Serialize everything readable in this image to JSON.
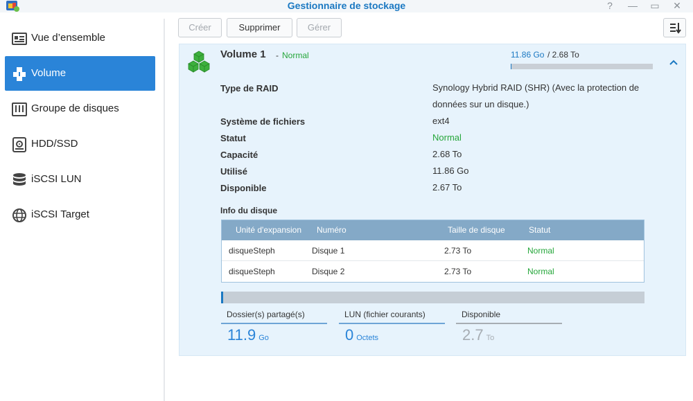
{
  "window": {
    "title": "Gestionnaire de stockage",
    "help_glyph": "?",
    "minimize_glyph": "—",
    "maximize_glyph": "▭",
    "close_glyph": "✕"
  },
  "sidebar": {
    "items": [
      {
        "label": "Vue d’ensemble",
        "icon": "overview-icon",
        "active": false
      },
      {
        "label": "Volume",
        "icon": "volume-icon",
        "active": true
      },
      {
        "label": "Groupe de disques",
        "icon": "disk-group-icon",
        "active": false
      },
      {
        "label": "HDD/SSD",
        "icon": "hdd-icon",
        "active": false
      },
      {
        "label": "iSCSI LUN",
        "icon": "iscsi-lun-icon",
        "active": false
      },
      {
        "label": "iSCSI Target",
        "icon": "iscsi-target-icon",
        "active": false
      }
    ]
  },
  "toolbar": {
    "create_label": "Créer",
    "delete_label": "Supprimer",
    "manage_label": "Gérer"
  },
  "volume": {
    "name": "Volume 1",
    "separator": "-",
    "status": "Normal",
    "used": "11.86 Go",
    "total_text": "/ 2.68 To",
    "usage_fraction": 0.004,
    "properties": {
      "raid_label": "Type de RAID",
      "raid_value": "Synology Hybrid RAID (SHR) (Avec la protection de données sur un disque.)",
      "fs_label": "Système de fichiers",
      "fs_value": "ext4",
      "status_label": "Statut",
      "status_value": "Normal",
      "capacity_label": "Capacité",
      "capacity_value": "2.68 To",
      "used_label": "Utilisé",
      "used_value": "11.86 Go",
      "available_label": "Disponible",
      "available_value": "2.67 To"
    },
    "disk_info_title": "Info du disque",
    "disk_table": {
      "headers": [
        "Unité d'expansion",
        "Numéro",
        "Taille de disque",
        "Statut"
      ],
      "rows": [
        [
          "disqueSteph",
          "Disque 1",
          "2.73 To",
          "Normal"
        ],
        [
          "disqueSteph",
          "Disque 2",
          "2.73 To",
          "Normal"
        ]
      ]
    },
    "allocation_fraction": 0.004,
    "stats": {
      "shared": {
        "label": "Dossier(s) partagé(s)",
        "value": "11.9",
        "unit": "Go"
      },
      "lun": {
        "label": "LUN (fichier courants)",
        "value": "0",
        "unit": "Octets"
      },
      "available": {
        "label": "Disponible",
        "value": "2.7",
        "unit": "To"
      }
    }
  },
  "colors": {
    "accent": "#2a84d8",
    "status_ok": "#25a63a",
    "volume_icon": "#3db03d"
  }
}
